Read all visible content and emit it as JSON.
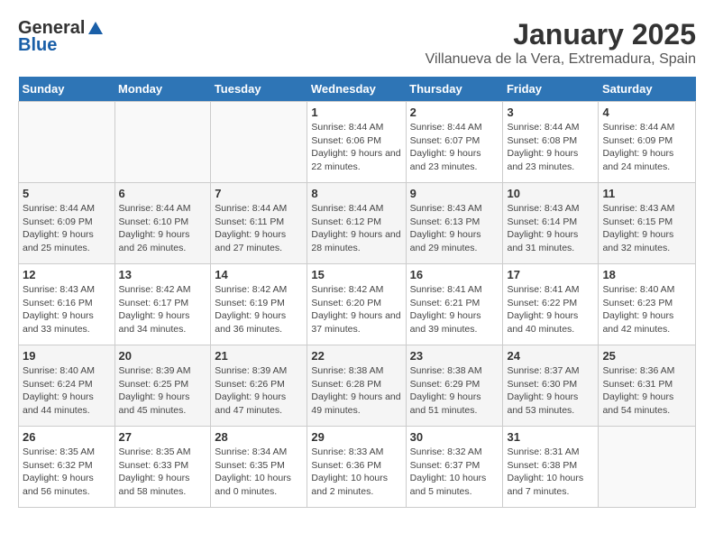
{
  "header": {
    "logo_general": "General",
    "logo_blue": "Blue",
    "title": "January 2025",
    "subtitle": "Villanueva de la Vera, Extremadura, Spain"
  },
  "weekdays": [
    "Sunday",
    "Monday",
    "Tuesday",
    "Wednesday",
    "Thursday",
    "Friday",
    "Saturday"
  ],
  "weeks": [
    [
      {
        "day": "",
        "info": ""
      },
      {
        "day": "",
        "info": ""
      },
      {
        "day": "",
        "info": ""
      },
      {
        "day": "1",
        "info": "Sunrise: 8:44 AM\nSunset: 6:06 PM\nDaylight: 9 hours and 22 minutes."
      },
      {
        "day": "2",
        "info": "Sunrise: 8:44 AM\nSunset: 6:07 PM\nDaylight: 9 hours and 23 minutes."
      },
      {
        "day": "3",
        "info": "Sunrise: 8:44 AM\nSunset: 6:08 PM\nDaylight: 9 hours and 23 minutes."
      },
      {
        "day": "4",
        "info": "Sunrise: 8:44 AM\nSunset: 6:09 PM\nDaylight: 9 hours and 24 minutes."
      }
    ],
    [
      {
        "day": "5",
        "info": "Sunrise: 8:44 AM\nSunset: 6:09 PM\nDaylight: 9 hours and 25 minutes."
      },
      {
        "day": "6",
        "info": "Sunrise: 8:44 AM\nSunset: 6:10 PM\nDaylight: 9 hours and 26 minutes."
      },
      {
        "day": "7",
        "info": "Sunrise: 8:44 AM\nSunset: 6:11 PM\nDaylight: 9 hours and 27 minutes."
      },
      {
        "day": "8",
        "info": "Sunrise: 8:44 AM\nSunset: 6:12 PM\nDaylight: 9 hours and 28 minutes."
      },
      {
        "day": "9",
        "info": "Sunrise: 8:43 AM\nSunset: 6:13 PM\nDaylight: 9 hours and 29 minutes."
      },
      {
        "day": "10",
        "info": "Sunrise: 8:43 AM\nSunset: 6:14 PM\nDaylight: 9 hours and 31 minutes."
      },
      {
        "day": "11",
        "info": "Sunrise: 8:43 AM\nSunset: 6:15 PM\nDaylight: 9 hours and 32 minutes."
      }
    ],
    [
      {
        "day": "12",
        "info": "Sunrise: 8:43 AM\nSunset: 6:16 PM\nDaylight: 9 hours and 33 minutes."
      },
      {
        "day": "13",
        "info": "Sunrise: 8:42 AM\nSunset: 6:17 PM\nDaylight: 9 hours and 34 minutes."
      },
      {
        "day": "14",
        "info": "Sunrise: 8:42 AM\nSunset: 6:19 PM\nDaylight: 9 hours and 36 minutes."
      },
      {
        "day": "15",
        "info": "Sunrise: 8:42 AM\nSunset: 6:20 PM\nDaylight: 9 hours and 37 minutes."
      },
      {
        "day": "16",
        "info": "Sunrise: 8:41 AM\nSunset: 6:21 PM\nDaylight: 9 hours and 39 minutes."
      },
      {
        "day": "17",
        "info": "Sunrise: 8:41 AM\nSunset: 6:22 PM\nDaylight: 9 hours and 40 minutes."
      },
      {
        "day": "18",
        "info": "Sunrise: 8:40 AM\nSunset: 6:23 PM\nDaylight: 9 hours and 42 minutes."
      }
    ],
    [
      {
        "day": "19",
        "info": "Sunrise: 8:40 AM\nSunset: 6:24 PM\nDaylight: 9 hours and 44 minutes."
      },
      {
        "day": "20",
        "info": "Sunrise: 8:39 AM\nSunset: 6:25 PM\nDaylight: 9 hours and 45 minutes."
      },
      {
        "day": "21",
        "info": "Sunrise: 8:39 AM\nSunset: 6:26 PM\nDaylight: 9 hours and 47 minutes."
      },
      {
        "day": "22",
        "info": "Sunrise: 8:38 AM\nSunset: 6:28 PM\nDaylight: 9 hours and 49 minutes."
      },
      {
        "day": "23",
        "info": "Sunrise: 8:38 AM\nSunset: 6:29 PM\nDaylight: 9 hours and 51 minutes."
      },
      {
        "day": "24",
        "info": "Sunrise: 8:37 AM\nSunset: 6:30 PM\nDaylight: 9 hours and 53 minutes."
      },
      {
        "day": "25",
        "info": "Sunrise: 8:36 AM\nSunset: 6:31 PM\nDaylight: 9 hours and 54 minutes."
      }
    ],
    [
      {
        "day": "26",
        "info": "Sunrise: 8:35 AM\nSunset: 6:32 PM\nDaylight: 9 hours and 56 minutes."
      },
      {
        "day": "27",
        "info": "Sunrise: 8:35 AM\nSunset: 6:33 PM\nDaylight: 9 hours and 58 minutes."
      },
      {
        "day": "28",
        "info": "Sunrise: 8:34 AM\nSunset: 6:35 PM\nDaylight: 10 hours and 0 minutes."
      },
      {
        "day": "29",
        "info": "Sunrise: 8:33 AM\nSunset: 6:36 PM\nDaylight: 10 hours and 2 minutes."
      },
      {
        "day": "30",
        "info": "Sunrise: 8:32 AM\nSunset: 6:37 PM\nDaylight: 10 hours and 5 minutes."
      },
      {
        "day": "31",
        "info": "Sunrise: 8:31 AM\nSunset: 6:38 PM\nDaylight: 10 hours and 7 minutes."
      },
      {
        "day": "",
        "info": ""
      }
    ]
  ]
}
